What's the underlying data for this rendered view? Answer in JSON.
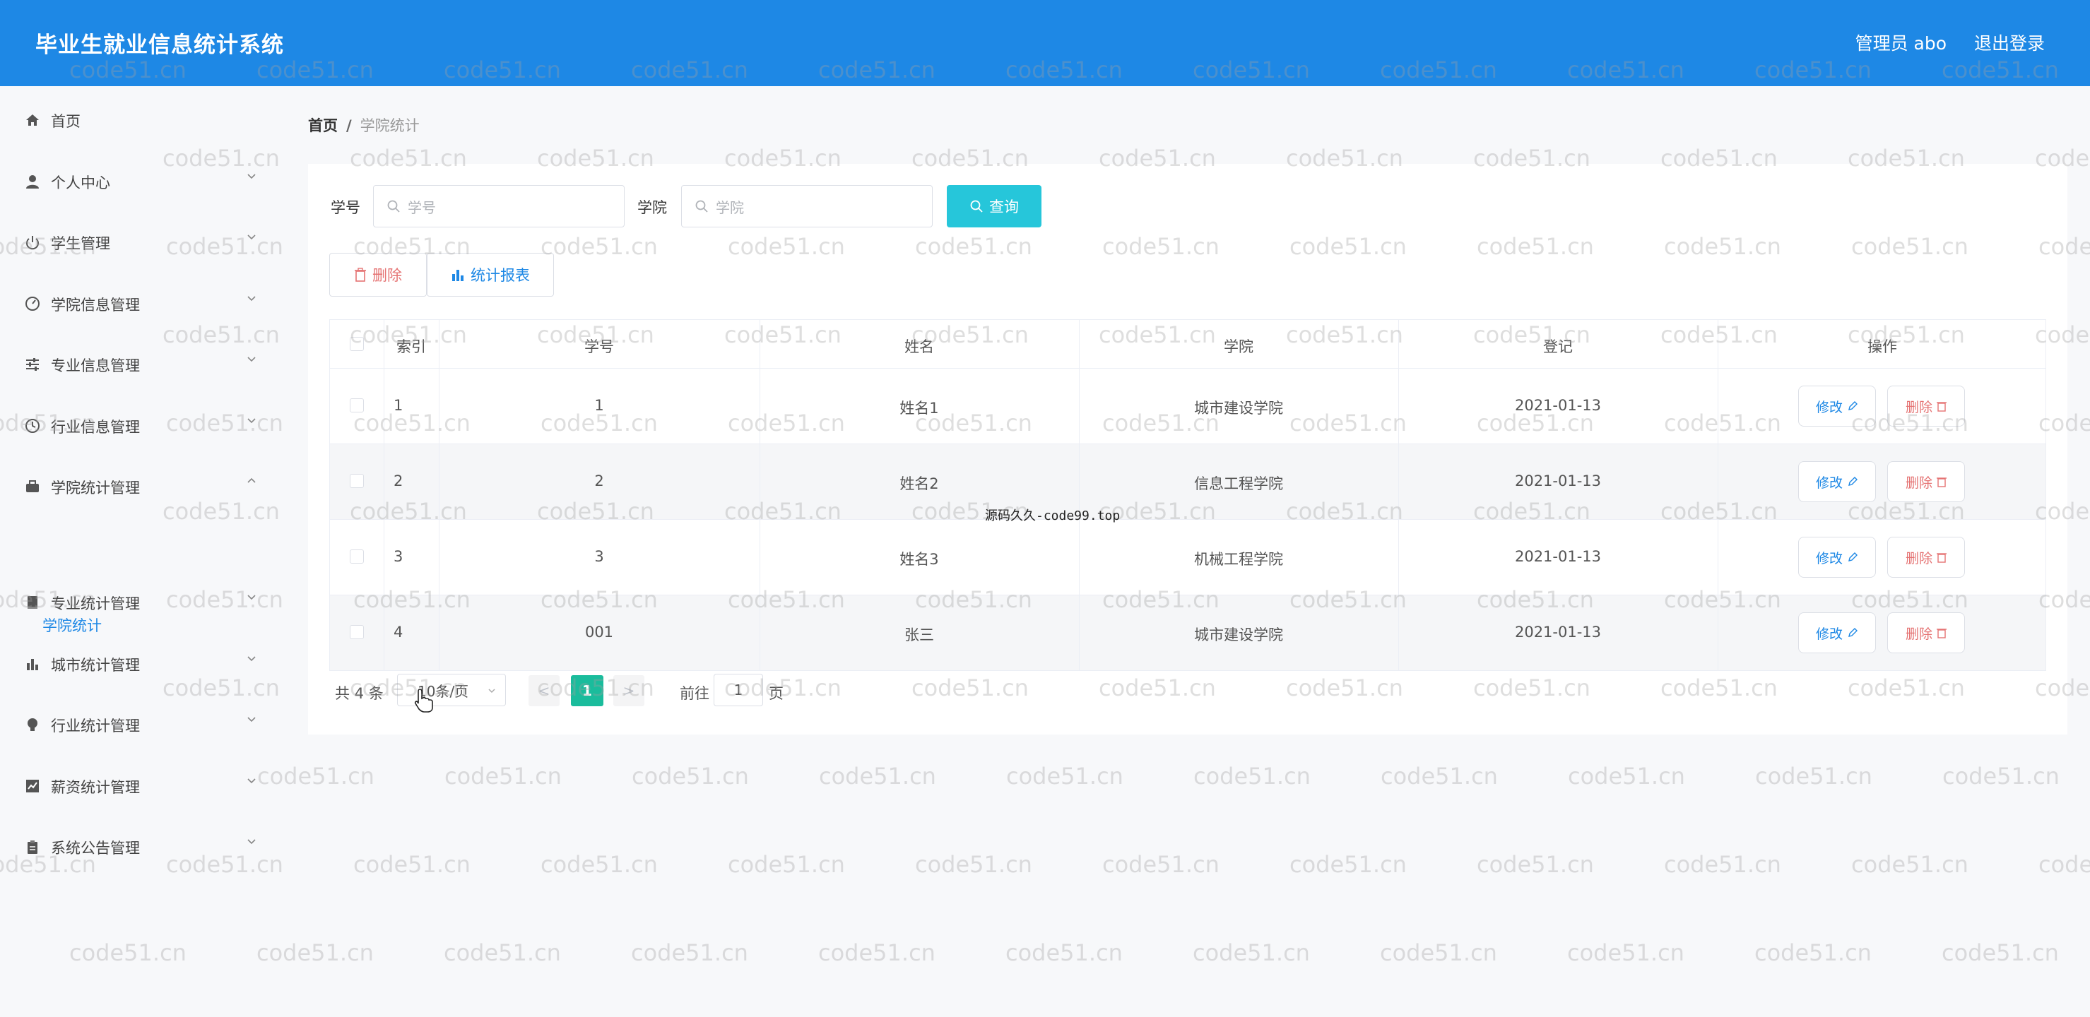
{
  "header": {
    "title": "毕业生就业信息统计系统",
    "user": "管理员 abo",
    "logout": "退出登录"
  },
  "sidebar": {
    "items": [
      {
        "label": "首页",
        "icon": "home-icon",
        "expandable": false
      },
      {
        "label": "个人中心",
        "icon": "user-icon",
        "expandable": true
      },
      {
        "label": "学生管理",
        "icon": "power-icon",
        "expandable": true
      },
      {
        "label": "学院信息管理",
        "icon": "gauge-icon",
        "expandable": true
      },
      {
        "label": "专业信息管理",
        "icon": "sliders-icon",
        "expandable": true
      },
      {
        "label": "行业信息管理",
        "icon": "clock-icon",
        "expandable": true
      },
      {
        "label": "学院统计管理",
        "icon": "briefcase-icon",
        "expandable": true
      },
      {
        "label": "专业统计管理",
        "icon": "book-icon",
        "expandable": true
      },
      {
        "label": "城市统计管理",
        "icon": "bar-chart-icon",
        "expandable": true
      },
      {
        "label": "行业统计管理",
        "icon": "bulb-icon",
        "expandable": true
      },
      {
        "label": "薪资统计管理",
        "icon": "line-chart-icon",
        "expandable": true
      },
      {
        "label": "系统公告管理",
        "icon": "clipboard-icon",
        "expandable": true
      }
    ],
    "active_sub": "学院统计"
  },
  "breadcrumb": {
    "home": "首页",
    "sep": "/",
    "current": "学院统计"
  },
  "search": {
    "xuehao_label": "学号",
    "xuehao_placeholder": "学号",
    "xueyuan_label": "学院",
    "xueyuan_placeholder": "学院",
    "query_label": "查询"
  },
  "toolbar": {
    "delete_label": "删除",
    "stat_label": "统计报表"
  },
  "table": {
    "headers": [
      "索引",
      "学号",
      "姓名",
      "学院",
      "登记",
      "操作"
    ],
    "rows": [
      {
        "index": "1",
        "xuehao": "1",
        "name": "姓名1",
        "college": "城市建设学院",
        "date": "2021-01-13"
      },
      {
        "index": "2",
        "xuehao": "2",
        "name": "姓名2",
        "college": "信息工程学院",
        "date": "2021-01-13"
      },
      {
        "index": "3",
        "xuehao": "3",
        "name": "姓名3",
        "college": "机械工程学院",
        "date": "2021-01-13"
      },
      {
        "index": "4",
        "xuehao": "001",
        "name": "张三",
        "college": "城市建设学院",
        "date": "2021-01-13"
      }
    ],
    "edit_label": "修改",
    "delete_label": "删除"
  },
  "pagination": {
    "total": "共 4 条",
    "page_size": "10条/页",
    "prev": "<",
    "current": "1",
    "next": ">",
    "goto_label": "前往",
    "goto_value": "1",
    "page_suffix": "页"
  },
  "watermark": {
    "text": "code51.cn",
    "center_text": "源码久久-code99.top"
  },
  "colors": {
    "header_bg": "#1e88e5",
    "query_btn": "#26c6da",
    "pager_active": "#1abc9c",
    "danger": "#e57373",
    "primary": "#1e88e5"
  }
}
